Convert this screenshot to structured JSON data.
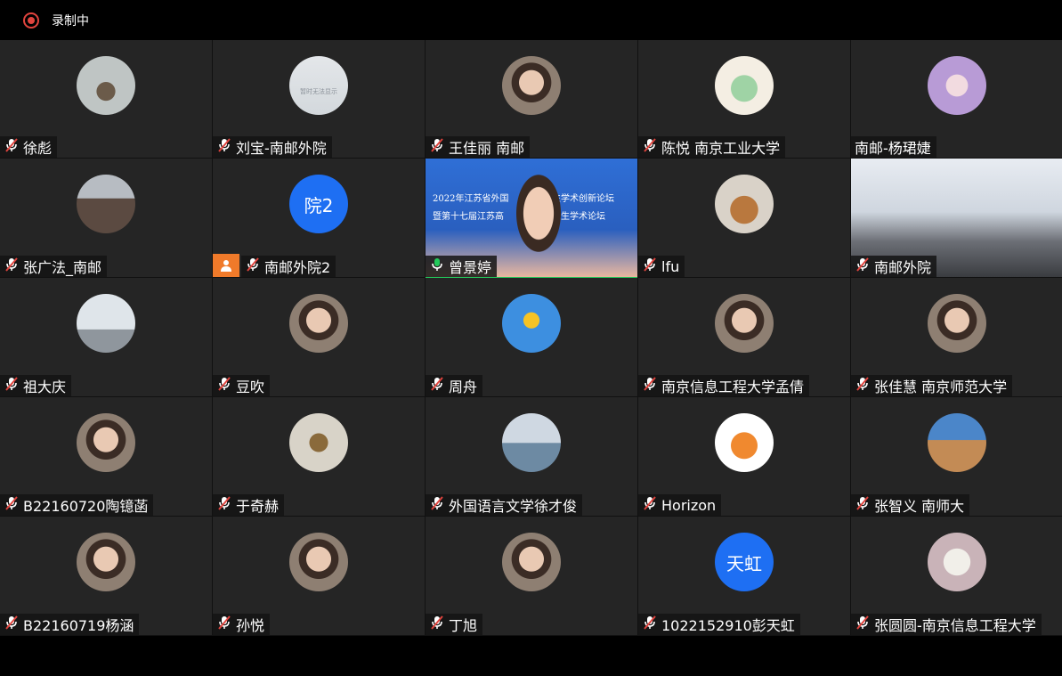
{
  "recording": {
    "label": "录制中"
  },
  "tiles": [
    {
      "name": "徐彪",
      "mic": "muted",
      "avatar": "photo-plant"
    },
    {
      "name": "刘宝-南邮外院",
      "mic": "muted",
      "avatar": "photo-blank",
      "avatar_caption": "暂时无法显示"
    },
    {
      "name": "王佳丽 南邮",
      "mic": "muted",
      "avatar": "photo-person"
    },
    {
      "name": "陈悦 南京工业大学",
      "mic": "muted",
      "avatar": "photo-cartoon"
    },
    {
      "name": "南邮-杨珺婕",
      "mic": "none",
      "avatar": "photo-anime"
    },
    {
      "name": "张广法_南邮",
      "mic": "muted",
      "avatar": "photo-street"
    },
    {
      "name": "南邮外院2",
      "mic": "muted",
      "avatar": "text",
      "avatar_text": "院2",
      "badge": "person-icon"
    },
    {
      "name": "曾景婷",
      "mic": "active",
      "video": "screen-share",
      "share_lines": [
        "2022年江苏省外国",
        "生学术创新论坛",
        "暨第十七届江苏高",
        "究生学术论坛"
      ]
    },
    {
      "name": "lfu",
      "mic": "muted",
      "avatar": "photo-dog"
    },
    {
      "name": "南邮外院",
      "mic": "muted",
      "video": "room"
    },
    {
      "name": "祖大庆",
      "mic": "muted",
      "avatar": "photo-birds"
    },
    {
      "name": "豆吹",
      "mic": "muted",
      "avatar": "photo-person"
    },
    {
      "name": "周舟",
      "mic": "muted",
      "avatar": "photo-smiley"
    },
    {
      "name": "南京信息工程大学孟倩",
      "mic": "muted",
      "avatar": "photo-person"
    },
    {
      "name": "张佳慧 南京师范大学",
      "mic": "muted",
      "avatar": "photo-person"
    },
    {
      "name": "B22160720陶镱菡",
      "mic": "muted",
      "avatar": "photo-person"
    },
    {
      "name": "于奇赫",
      "mic": "muted",
      "avatar": "photo-insect"
    },
    {
      "name": "外国语言文学徐才俊",
      "mic": "muted",
      "avatar": "photo-sea"
    },
    {
      "name": "Horizon",
      "mic": "muted",
      "avatar": "photo-fox"
    },
    {
      "name": "张智义 南师大",
      "mic": "muted",
      "avatar": "photo-travel"
    },
    {
      "name": "B22160719杨涵",
      "mic": "muted",
      "avatar": "photo-person"
    },
    {
      "name": "孙悦",
      "mic": "muted",
      "avatar": "photo-person"
    },
    {
      "name": "丁旭",
      "mic": "muted",
      "avatar": "photo-person"
    },
    {
      "name": "1022152910彭天虹",
      "mic": "muted",
      "avatar": "text",
      "avatar_text": "天虹"
    },
    {
      "name": "张圆圆-南京信息工程大学",
      "mic": "muted",
      "avatar": "photo-plush"
    }
  ],
  "colors": {
    "tile_bg": "#252525",
    "text_avatar": "#1e6ff3",
    "active_speaker": "#23c95b",
    "record": "#e0443e",
    "badge": "#f07a2a"
  }
}
